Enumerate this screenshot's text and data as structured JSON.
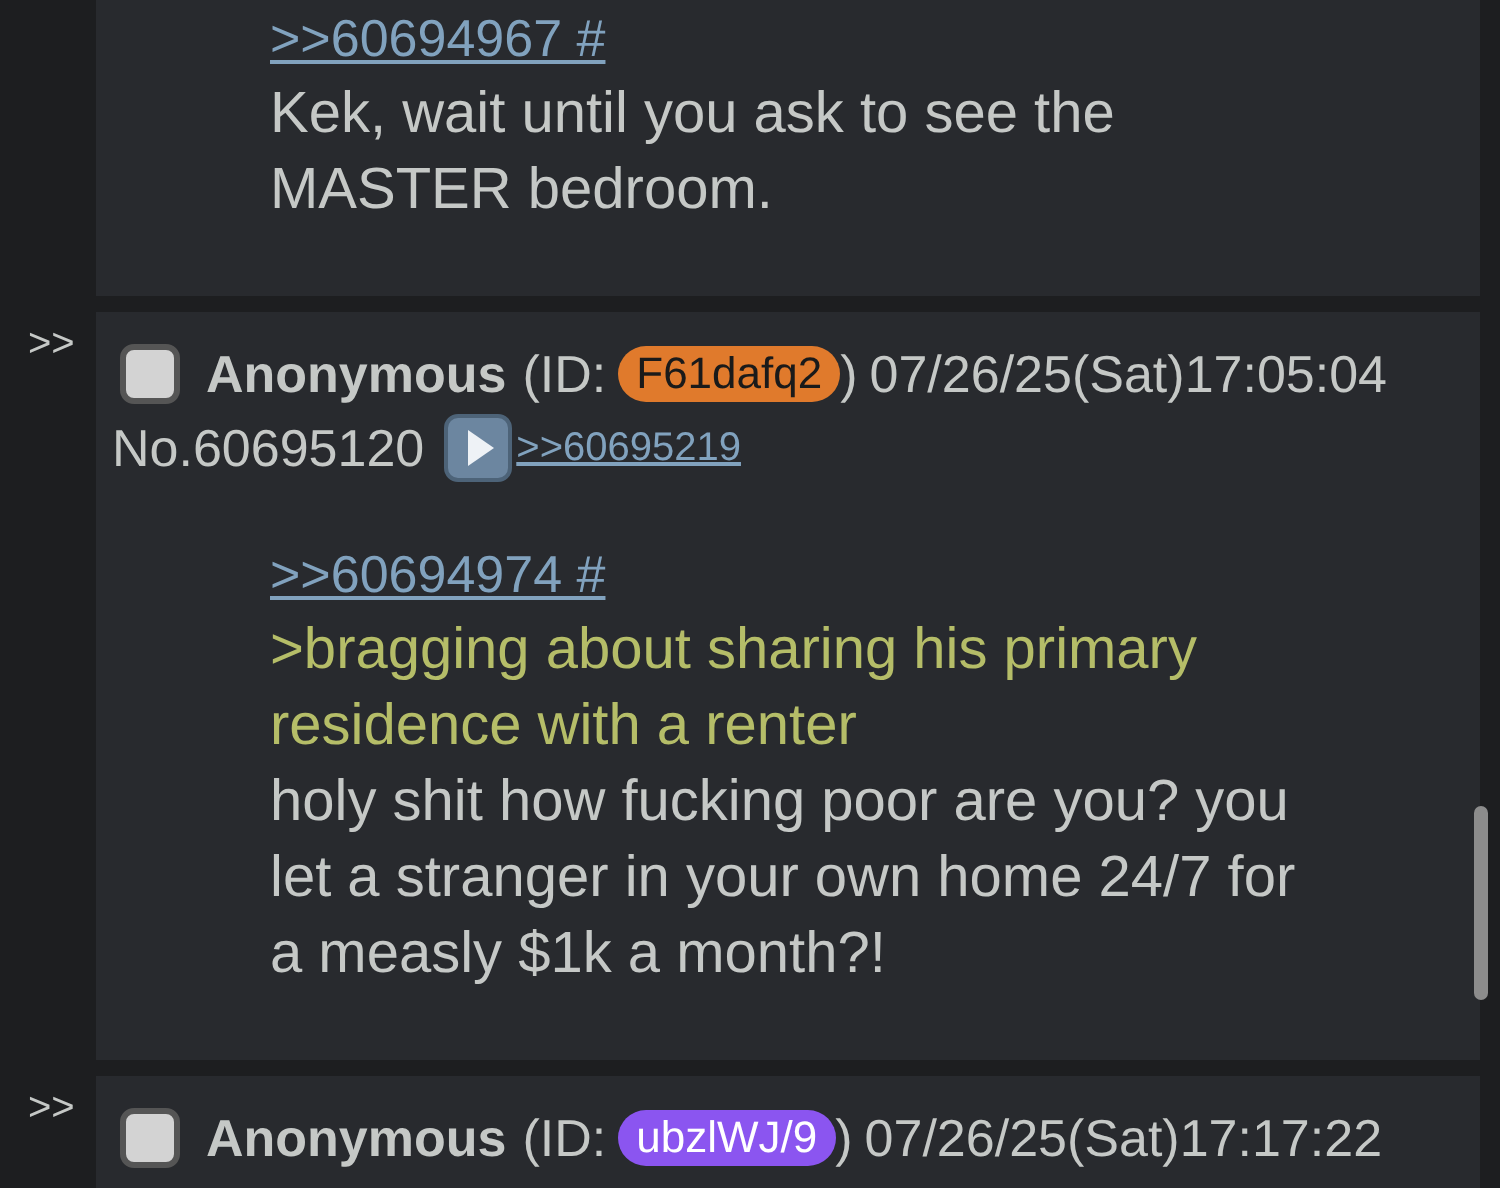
{
  "posts": [
    {
      "message": [
        {
          "kind": "quote",
          "text": ">>60694967 #"
        },
        {
          "kind": "text",
          "text": "Kek, wait until you ask to see the MASTER bedroom."
        }
      ]
    },
    {
      "arrow": ">>",
      "header": {
        "checked": false,
        "name": "Anonymous",
        "id_prefix": "(ID:",
        "id": "F61dafq2",
        "color": "#e07a2c",
        "id_suffix": ")",
        "datetime": "07/26/25(Sat)17:05:04",
        "number": "No.60695120",
        "backlink": ">>60695219"
      },
      "message": [
        {
          "kind": "quote",
          "text": ">>60694974 #"
        },
        {
          "kind": "greentext",
          "text": ">bragging about sharing his primary residence with a renter"
        },
        {
          "kind": "text",
          "text": "holy shit how fucking poor are you? you let a stranger in your own home 24/7 for a measly $1k a month?!"
        }
      ]
    },
    {
      "arrow": ">>",
      "header": {
        "checked": false,
        "name": "Anonymous",
        "id_prefix": "(ID:",
        "id": "ubzlWJ/9",
        "color": "#8b55f0",
        "id_suffix": ")",
        "datetime": "07/26/25(Sat)17:17:22"
      }
    }
  ]
}
